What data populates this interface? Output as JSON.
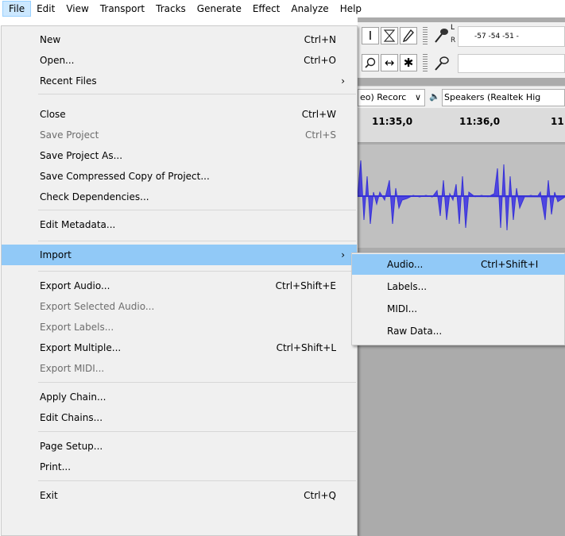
{
  "menubar": {
    "items": [
      "File",
      "Edit",
      "View",
      "Transport",
      "Tracks",
      "Generate",
      "Effect",
      "Analyze",
      "Help"
    ],
    "active": "File"
  },
  "file_menu": {
    "new": {
      "label": "New",
      "shortcut": "Ctrl+N"
    },
    "open": {
      "label": "Open...",
      "shortcut": "Ctrl+O"
    },
    "recent": {
      "label": "Recent Files",
      "arrow": "›"
    },
    "close": {
      "label": "Close",
      "shortcut": "Ctrl+W"
    },
    "save": {
      "label": "Save Project",
      "shortcut": "Ctrl+S"
    },
    "save_as": {
      "label": "Save Project As..."
    },
    "save_compressed": {
      "label": "Save Compressed Copy of Project..."
    },
    "check_deps": {
      "label": "Check Dependencies..."
    },
    "edit_metadata": {
      "label": "Edit Metadata..."
    },
    "import": {
      "label": "Import",
      "arrow": "›"
    },
    "export_audio": {
      "label": "Export Audio...",
      "shortcut": "Ctrl+Shift+E"
    },
    "export_selected": {
      "label": "Export Selected Audio..."
    },
    "export_labels": {
      "label": "Export Labels..."
    },
    "export_multiple": {
      "label": "Export Multiple...",
      "shortcut": "Ctrl+Shift+L"
    },
    "export_midi": {
      "label": "Export MIDI..."
    },
    "apply_chain": {
      "label": "Apply Chain..."
    },
    "edit_chains": {
      "label": "Edit Chains..."
    },
    "page_setup": {
      "label": "Page Setup..."
    },
    "print": {
      "label": "Print..."
    },
    "exit": {
      "label": "Exit",
      "shortcut": "Ctrl+Q"
    }
  },
  "import_submenu": {
    "audio": {
      "label": "Audio...",
      "shortcut": "Ctrl+Shift+I"
    },
    "labels": {
      "label": "Labels..."
    },
    "midi": {
      "label": "MIDI..."
    },
    "raw": {
      "label": "Raw Data..."
    }
  },
  "background": {
    "recording_channels": "eo) Recorc",
    "dropdown_arrow": "∨",
    "speaker_icon": "🔈",
    "playback_device": "Speakers (Realtek Hig",
    "ruler_ticks": [
      "11:35,0",
      "11:36,0",
      "11:"
    ],
    "meter_scale": "-57 -54 -51 -",
    "meter_l": "L",
    "meter_r": "R"
  },
  "colors": {
    "highlight": "#91c9f7",
    "menu_bg": "#f0f0f0",
    "waveform": "#3732d8"
  }
}
